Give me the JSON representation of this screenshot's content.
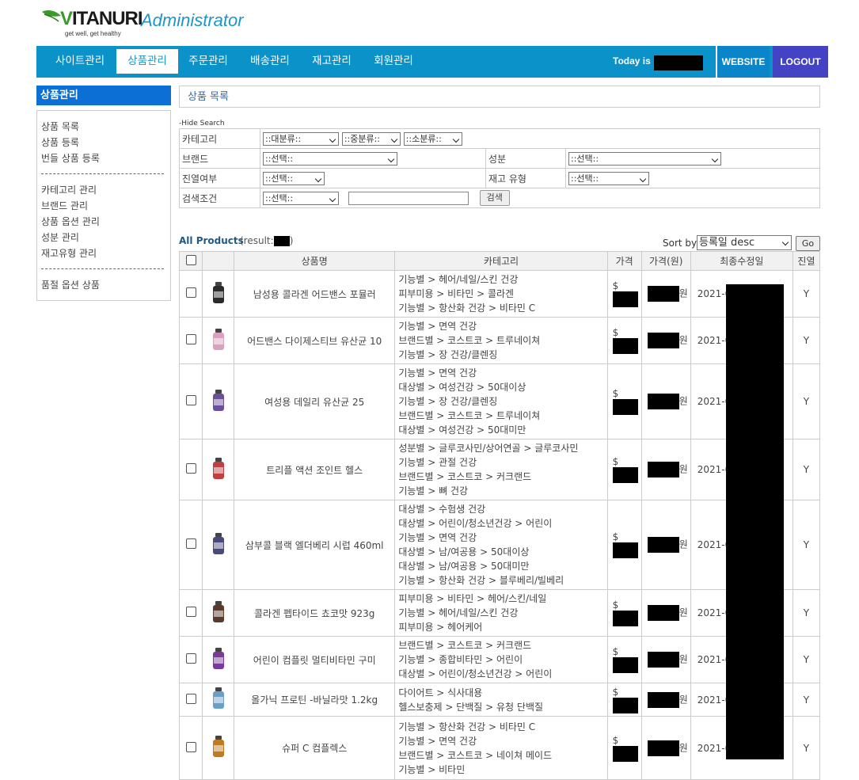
{
  "brand": {
    "logo_text_v": "V",
    "logo_text_rest": "ITANURI",
    "tagline": "get well, get healthy",
    "title": "Administrator"
  },
  "nav": {
    "items": [
      {
        "label": "사이트관리"
      },
      {
        "label": "상품관리",
        "active": true
      },
      {
        "label": "주문관리"
      },
      {
        "label": "배송관리"
      },
      {
        "label": "재고관리"
      },
      {
        "label": "회원관리"
      }
    ],
    "today_label": "Today is",
    "website": "WEBSITE",
    "logout": "LOGOUT"
  },
  "sidebar": {
    "heading": "상품관리",
    "group1": [
      "상품 목록",
      "상품 등록",
      "번들 상품 등록"
    ],
    "group2": [
      "카테고리 관리",
      "브랜드 관리",
      "상품 옵션 관리",
      "성분 관리",
      "재고유형 관리"
    ],
    "group3": [
      "품절 옵션 상품"
    ]
  },
  "page_title": "상품 목록",
  "search": {
    "toggle": "-Hide Search",
    "labels": {
      "category": "카테고리",
      "brand": "브랜드",
      "ingredient": "성분",
      "display": "진열여부",
      "stock_type": "재고 유형",
      "condition": "검색조건"
    },
    "category_major": "::대분류::",
    "category_middle": "::중분류::",
    "category_minor": "::소분류::",
    "select_default": "::선택::",
    "button": "검색"
  },
  "list": {
    "all_products": "All Products",
    "result_prefix": "(result:",
    "result_suffix": ")",
    "sort_label": "Sort by",
    "sort_value": "등록일 desc",
    "go": "Go",
    "headers": [
      "상품명",
      "카테고리",
      "가격",
      "가격(원)",
      "최종수정일",
      "진열"
    ]
  },
  "rows": [
    {
      "name": "남성용 콜라겐 어드밴스 포뮬러",
      "cats": [
        "기능별 > 헤어/네일/스킨 건강",
        "피부미용 > 비타민 > 콜라겐",
        "기능별 > 항산화 건강 > 비타민 C"
      ],
      "usd": "$",
      "krw": "원",
      "date": "2021-0",
      "display": "Y"
    },
    {
      "name": "어드밴스 다이제스티브 유산균 10",
      "cats": [
        "기능별 > 면역 건강",
        "브랜드별 > 코스트코 > 트루네이쳐",
        "기능별 > 장 건강/클렌징"
      ],
      "usd": "$",
      "krw": "원",
      "date": "2021-0",
      "display": "Y"
    },
    {
      "name": "여성용 데일리 유산균 25",
      "cats": [
        "기능별 > 면역 건강",
        "대상별 > 여성건강 > 50대이상",
        "기능별 > 장 건강/클렌징",
        "브랜드별 > 코스트코 > 트루네이쳐",
        "대상별 > 여성건강 > 50대미만"
      ],
      "usd": "$",
      "krw": "원",
      "date": "2021-0",
      "display": "Y"
    },
    {
      "name": "트리플 액션 조인트 헬스",
      "cats": [
        "성분별 > 글루코사민/상어연골 > 글루코사민",
        "기능별 > 관절 건강",
        "브랜드별 > 코스트코 > 커크랜드",
        "기능별 > 뼈 건강"
      ],
      "usd": "$",
      "krw": "원",
      "date": "2021-0",
      "display": "Y"
    },
    {
      "name": "삼부콜 블랙 엘더베리 시럽 460ml",
      "cats": [
        "대상별 > 수험생 건강",
        "대상별 > 어린이/청소년건강 > 어린이",
        "기능별 > 면역 건강",
        "대상별 > 남/여공용 > 50대이상",
        "대상별 > 남/여공용 > 50대미만",
        "기능별 > 항산화 건강 > 블루베리/빌베리"
      ],
      "usd": "$",
      "krw": "원",
      "date": "2021-0",
      "display": "Y"
    },
    {
      "name": "콜라겐 펩타이드 쵸코맛 923g",
      "cats": [
        "피부미용 > 비타민 > 헤어/스킨/네일",
        "기능별 > 헤어/네일/스킨 건강",
        "피부미용 > 헤어케어"
      ],
      "usd": "$",
      "krw": "원",
      "date": "2021-0",
      "display": "Y"
    },
    {
      "name": "어린이 컴플릿 멀티비타민 구미",
      "cats": [
        "브랜드별 > 코스트코 > 커크랜드",
        "기능별 > 종합비타민 > 어린이",
        "대상별 > 어린이/청소년건강 > 어린이"
      ],
      "usd": "$",
      "krw": "원",
      "date": "2021-0",
      "display": "Y"
    },
    {
      "name": "올가닉 프로틴 -바닐라맛 1.2kg",
      "cats": [
        "다이어트 > 식사대용",
        "헬스보충제 > 단백질 > 유청 단백질"
      ],
      "usd": "$",
      "krw": "원",
      "date": "2021-0",
      "display": "Y"
    },
    {
      "name": "슈퍼 C 컴플렉스",
      "cats": [
        "기능별 > 항산화 건강 > 비타민 C",
        "기능별 > 면역 건강",
        "브랜드별 > 코스트코 > 네이쳐 메이드",
        "기능별 > 비타민"
      ],
      "usd": "$",
      "krw": "원",
      "date": "2021-0",
      "display": "Y"
    }
  ],
  "thumb_colors": [
    "#2b2b2b",
    "#d9a0c0",
    "#6a4f9b",
    "#c04040",
    "#4a4a7a",
    "#5a3a2a",
    "#7a3a9a",
    "#6aa0c8",
    "#c07a20"
  ]
}
